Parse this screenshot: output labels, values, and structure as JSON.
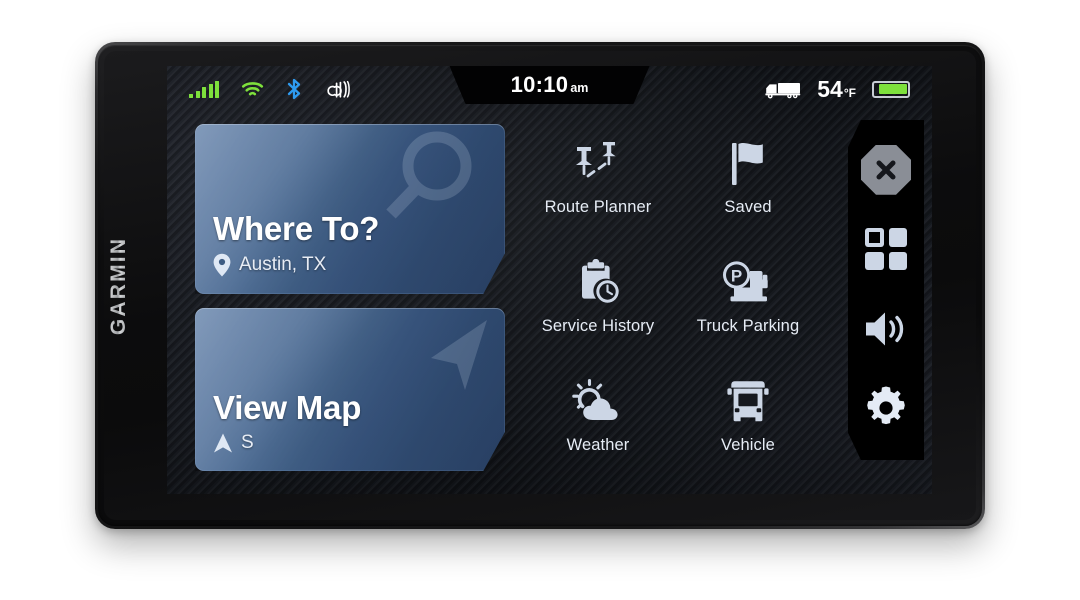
{
  "device": {
    "brand": "GARMIN"
  },
  "statusbar": {
    "signal_icon": "signal-bars-icon",
    "wifi_icon": "wifi-icon",
    "bluetooth_icon": "bluetooth-icon",
    "dezl_icon": "dezl-logo-icon",
    "clock_time": "10:10",
    "clock_ampm": "am",
    "truck_icon": "truck-icon",
    "temperature": "54",
    "temperature_unit": "°F",
    "battery_icon": "battery-full-icon"
  },
  "cards": [
    {
      "id": "where-to",
      "title": "Where To?",
      "sub": "Austin, TX",
      "sub_icon": "map-pin-icon",
      "watermark_icon": "magnifier-icon"
    },
    {
      "id": "view-map",
      "title": "View Map",
      "sub": "S",
      "sub_icon": "navigation-arrow-icon",
      "watermark_icon": "navigation-arrow-icon"
    }
  ],
  "apps": [
    {
      "label": "Route Planner",
      "icon": "route-planner-icon"
    },
    {
      "label": "Saved",
      "icon": "flag-icon"
    },
    {
      "label": "Service History",
      "icon": "clipboard-clock-icon"
    },
    {
      "label": "Truck Parking",
      "icon": "truck-parking-icon"
    },
    {
      "label": "Weather",
      "icon": "sun-cloud-icon"
    },
    {
      "label": "Vehicle",
      "icon": "truck-front-icon"
    }
  ],
  "sidebar": [
    {
      "name": "close",
      "icon": "close-x-octagon-icon"
    },
    {
      "name": "apps",
      "icon": "apps-grid-icon"
    },
    {
      "name": "volume",
      "icon": "volume-speaker-icon"
    },
    {
      "name": "settings",
      "icon": "gear-icon"
    }
  ],
  "colors": {
    "accent_green": "#7ee03c",
    "accent_blue": "#2e9bf0",
    "card_blue": "#3e5c82",
    "icon_light": "#ccd6e5",
    "screen_dark": "#16191f"
  }
}
